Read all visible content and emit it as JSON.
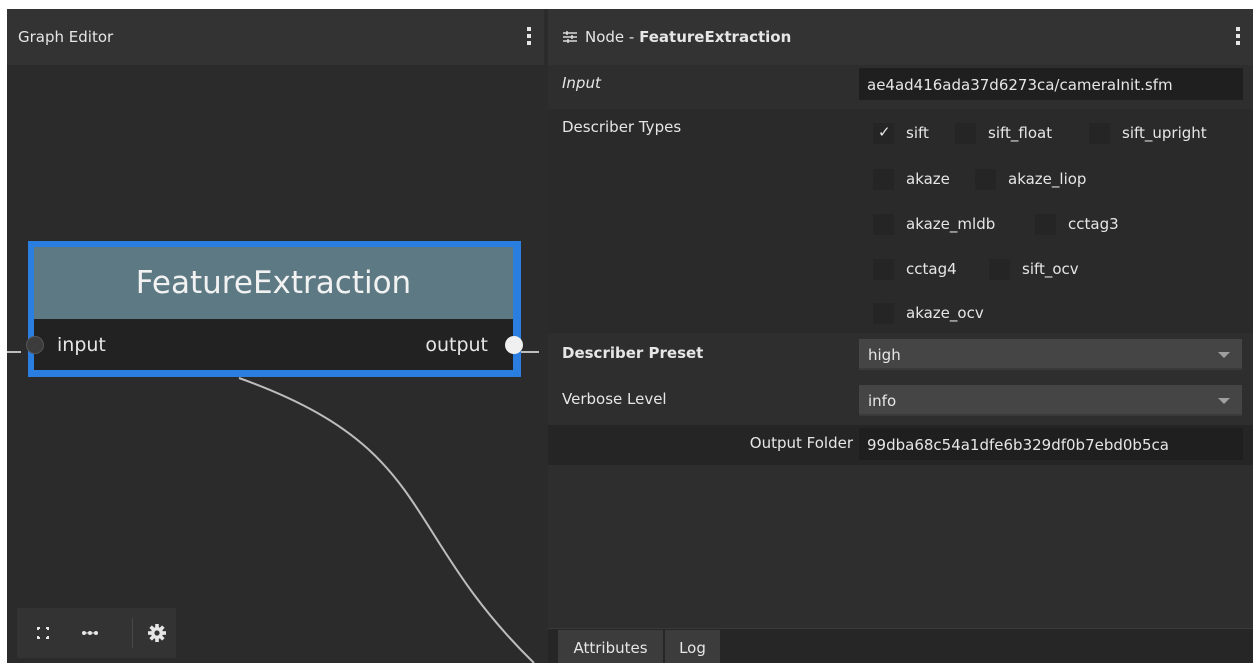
{
  "graph_editor": {
    "title": "Graph Editor",
    "node": {
      "title": "FeatureExtraction",
      "input_label": "input",
      "output_label": "output"
    },
    "toolbar": {
      "fit_icon": "fit-view-icon",
      "layout_icon": "dots-layout-icon",
      "settings_icon": "gear-icon"
    }
  },
  "node_editor": {
    "header_prefix": "Node - ",
    "header_node": "FeatureExtraction",
    "header_icon": "sliders-icon",
    "attributes": {
      "input": {
        "label": "Input",
        "value": "ae4ad416ada37d6273ca/cameraInit.sfm"
      },
      "describer_types": {
        "label": "Describer Types",
        "options": [
          {
            "label": "sift",
            "checked": true
          },
          {
            "label": "sift_float",
            "checked": false
          },
          {
            "label": "sift_upright",
            "checked": false
          },
          {
            "label": "akaze",
            "checked": false
          },
          {
            "label": "akaze_liop",
            "checked": false
          },
          {
            "label": "akaze_mldb",
            "checked": false
          },
          {
            "label": "cctag3",
            "checked": false
          },
          {
            "label": "cctag4",
            "checked": false
          },
          {
            "label": "sift_ocv",
            "checked": false
          },
          {
            "label": "akaze_ocv",
            "checked": false
          }
        ]
      },
      "describer_preset": {
        "label": "Describer Preset",
        "value": "high"
      },
      "verbose_level": {
        "label": "Verbose Level",
        "value": "info"
      },
      "output_folder": {
        "label": "Output Folder",
        "value": "99dba68c54a1dfe6b329df0b7ebd0b5ca"
      }
    },
    "tabs": [
      "Attributes",
      "Log"
    ]
  },
  "colors": {
    "selection_blue": "#2a7ee0",
    "node_title_bg": "#5d7a84",
    "panel_bg": "#2b2b2b"
  }
}
